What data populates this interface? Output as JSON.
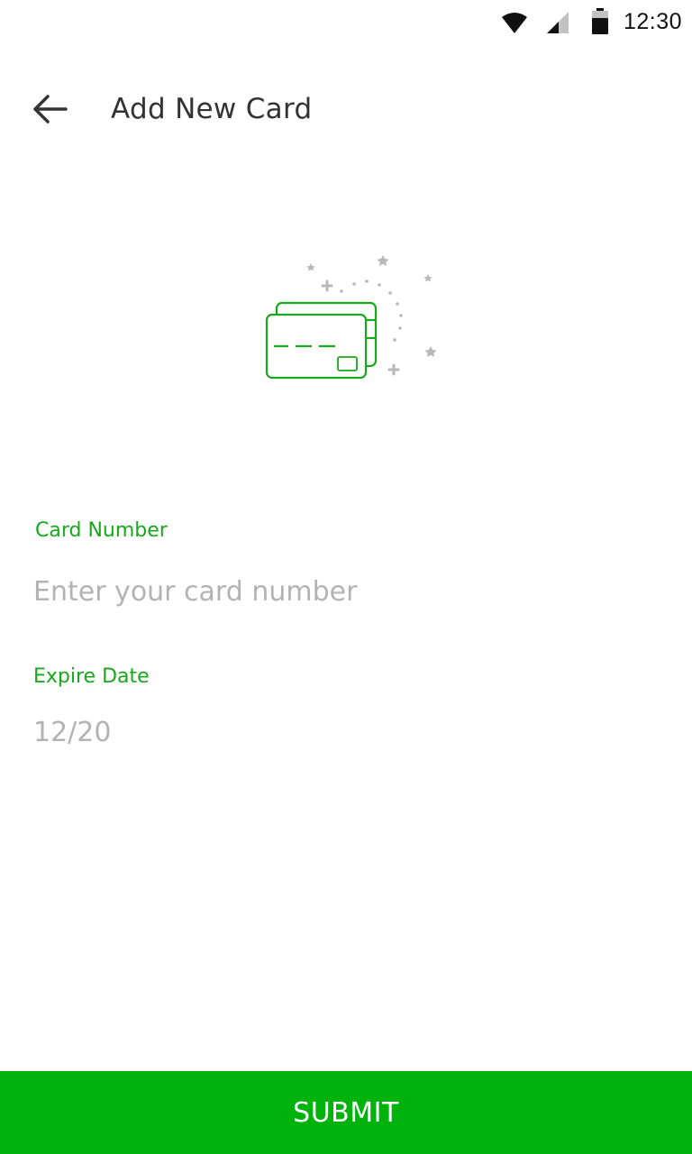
{
  "status_bar": {
    "time": "12:30",
    "icons": [
      "wifi-icon",
      "cell-signal-icon",
      "battery-icon"
    ]
  },
  "toolbar": {
    "back_icon": "arrow-back-icon",
    "title": "Add New Card"
  },
  "illustration": {
    "icon": "credit-cards-icon",
    "accent_color": "#17a81b",
    "sparkle_color": "#b8b8b8"
  },
  "form": {
    "card_number": {
      "label": "Card Number",
      "value": "",
      "placeholder": "Enter your card number"
    },
    "expire_date": {
      "label": "Expire Date",
      "value": "",
      "placeholder": "12/20"
    }
  },
  "submit": {
    "label": "SUBMIT",
    "color": "#00b30c"
  },
  "colors": {
    "accent": "#17a81b",
    "button": "#00b30c",
    "title_text": "#333333",
    "placeholder": "#b3b3b3"
  }
}
